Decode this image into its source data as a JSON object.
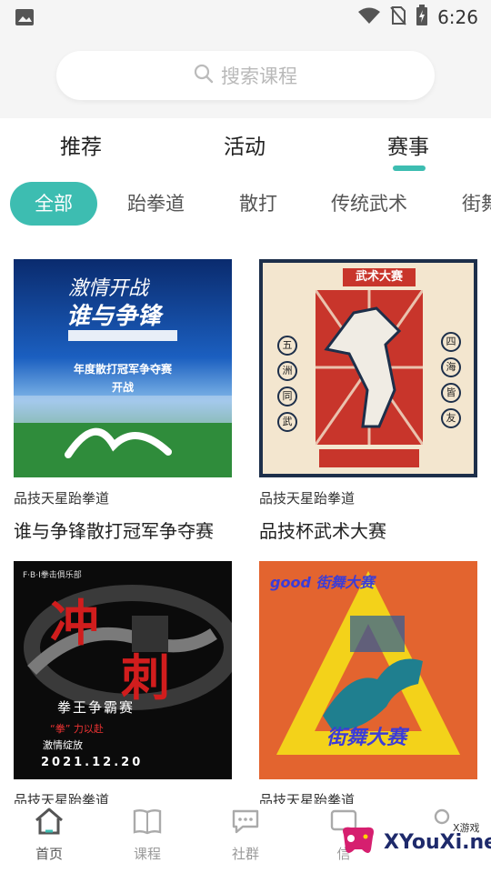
{
  "status_bar": {
    "time": "6:26"
  },
  "search": {
    "placeholder": "搜索课程"
  },
  "top_tabs": [
    {
      "label": "推荐"
    },
    {
      "label": "活动"
    },
    {
      "label": "赛事"
    }
  ],
  "categories": [
    {
      "label": "全部"
    },
    {
      "label": "跆拳道"
    },
    {
      "label": "散打"
    },
    {
      "label": "传统武术"
    },
    {
      "label": "街舞"
    }
  ],
  "cards": [
    {
      "org": "品技天星跆拳道",
      "title": "谁与争锋散打冠军争夺赛",
      "poster": {
        "line1": "激情开战",
        "line2": "谁与争锋",
        "sub": "年度散打冠军争夺赛",
        "sub2": "开战"
      }
    },
    {
      "org": "品技天星跆拳道",
      "title": "品技杯武术大赛",
      "poster": {
        "header": "武术大赛",
        "left": [
          "五",
          "洲",
          "同",
          "武"
        ],
        "right": [
          "四",
          "海",
          "皆",
          "友"
        ]
      }
    },
    {
      "org": "品技天星跆拳道",
      "title": "",
      "poster": {
        "club": "F·B·I拳击俱乐部",
        "big1": "冲",
        "big2": "刺",
        "sub": "拳王争霸赛",
        "slogan1": "“拳” 力以赴",
        "slogan2": "激情绽放",
        "date": "2021.12.20"
      }
    },
    {
      "org": "品技天星跆拳道",
      "title": "",
      "poster": {
        "top": "good 街舞大赛",
        "bottom": "街舞大赛"
      }
    }
  ],
  "bottom_nav": [
    {
      "label": "首页"
    },
    {
      "label": "课程"
    },
    {
      "label": "社群"
    },
    {
      "label": "信"
    },
    {
      "label": ""
    }
  ],
  "watermark": {
    "brand": "XYouXi.net",
    "small": "X游戏"
  },
  "colors": {
    "accent": "#3dbdb1"
  }
}
